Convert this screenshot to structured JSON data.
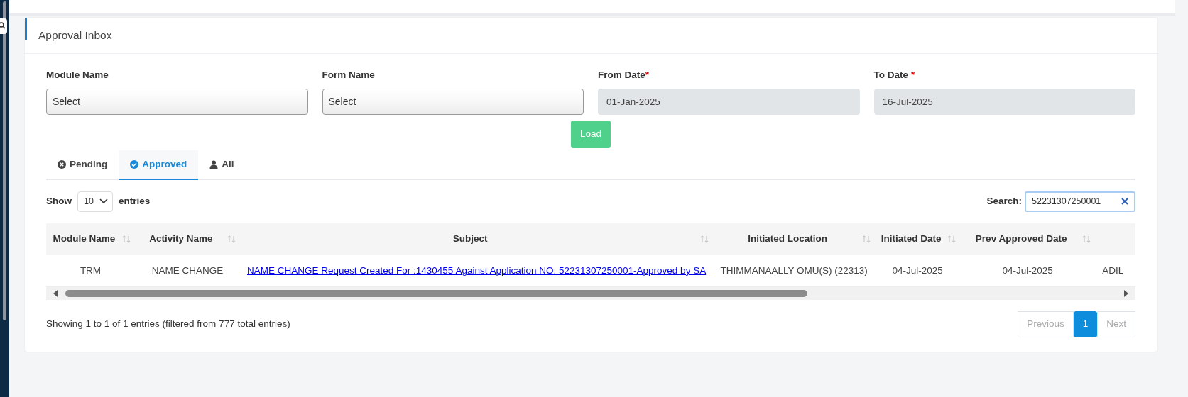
{
  "card": {
    "title": "Approval Inbox"
  },
  "filters": [
    {
      "label": "Module Name",
      "kind": "select",
      "value": "Select"
    },
    {
      "label": "Form Name",
      "kind": "select",
      "value": "Select"
    },
    {
      "label": "From Date",
      "required_mark": "*",
      "kind": "date",
      "value": "01-Jan-2025"
    },
    {
      "label": "To Date",
      "required_mark": "*",
      "kind": "date",
      "value": "16-Jul-2025"
    }
  ],
  "load_button": "Load",
  "tabs": [
    {
      "label": "Pending",
      "kind": "cross",
      "selected": false
    },
    {
      "label": "Approved",
      "kind": "check",
      "selected": true
    },
    {
      "label": "All",
      "kind": "user",
      "selected": false
    }
  ],
  "length": {
    "prefix": "Show",
    "value": "10",
    "suffix": "entries"
  },
  "search": {
    "label": "Search:",
    "value": "52231307250001"
  },
  "table": {
    "columns": [
      {
        "label": "Module Name",
        "sortable": true
      },
      {
        "label": "Activity Name",
        "sortable": true
      },
      {
        "label": "Subject",
        "sortable": true
      },
      {
        "label": "Initiated Location",
        "sortable": true
      },
      {
        "label": "Initiated Date",
        "sortable": true
      },
      {
        "label": "Prev Approved Date",
        "sortable": true
      }
    ],
    "rows": [
      {
        "cells": [
          {
            "text": "TRM",
            "kind": "text"
          },
          {
            "text": "NAME CHANGE",
            "kind": "text"
          },
          {
            "text": "NAME CHANGE Request Created For :1430455 Against Application NO: 52231307250001-Approved by SA",
            "kind": "link"
          },
          {
            "text": "THIMMANAALLY OMU(S) (22313)",
            "kind": "text"
          },
          {
            "text": "04-Jul-2025",
            "kind": "text"
          },
          {
            "text": "04-Jul-2025",
            "kind": "text"
          },
          {
            "text": "ADIL",
            "kind": "text"
          }
        ]
      }
    ]
  },
  "info": "Showing 1 to 1 of 1 entries (filtered from 777 total entries)",
  "pagination": [
    {
      "label": "Previous",
      "selected": false,
      "disabled": true
    },
    {
      "label": "1",
      "selected": true,
      "disabled": false
    },
    {
      "label": "Next",
      "selected": false,
      "disabled": true
    }
  ]
}
